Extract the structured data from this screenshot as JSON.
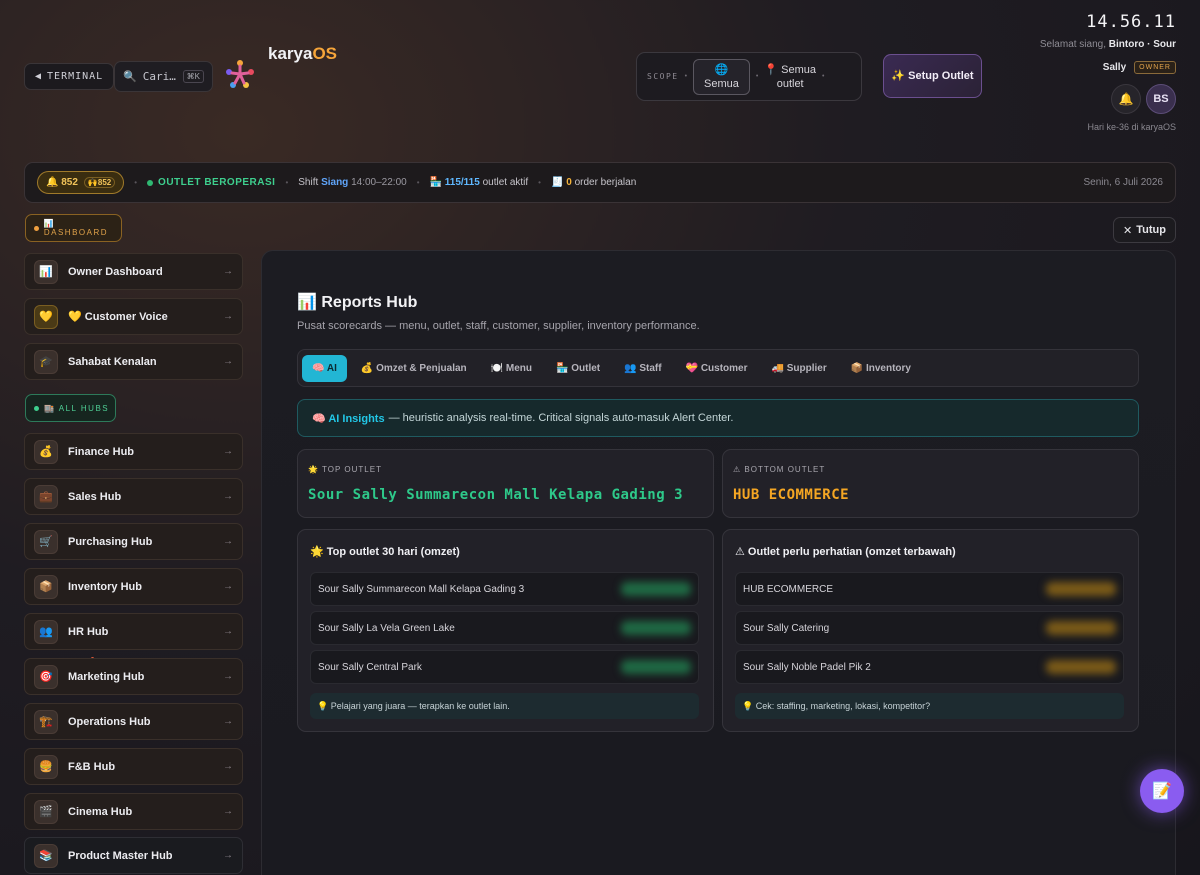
{
  "header": {
    "terminal_label": "TERMINAL",
    "search_placeholder": "Cari…",
    "search_shortcut": "⌘K",
    "brand_main": "karya",
    "brand_accent": "OS",
    "scope_label": "SCOPE",
    "scope_options": [
      "Semua",
      "Semua outlet"
    ],
    "setup_button": "✨ Setup Outlet",
    "clock": "14.56.11",
    "greeting_prefix": "Selamat siang,",
    "greeting_name": "Bintoro · Sour",
    "user_name": "Sally",
    "role_badge": "OWNER",
    "avatar_initials": "BS",
    "day_info": "Hari ke-36 di karyaOS"
  },
  "statusbar": {
    "counter_main": "🔔 852",
    "counter_inner": "🙌852",
    "status_text": "OUTLET BEROPERASI",
    "shift_label": "Shift",
    "shift_name": "Siang",
    "shift_time": "14:00–22:00",
    "outlet_icon": "🏪",
    "outlet_count": "115/115",
    "outlet_text": "outlet aktif",
    "order_icon": "🧾",
    "order_count": "0",
    "order_text": "order berjalan",
    "date": "Senin, 6 Juli 2026"
  },
  "sidebar": {
    "dashboard_badge": "📊 DASHBOARD",
    "hubs_badge": "🏬 ALL HUBS",
    "top_items": [
      {
        "icon": "📊",
        "label": "Owner Dashboard"
      },
      {
        "icon": "💛",
        "label": "💛 Customer Voice"
      },
      {
        "icon": "🎓",
        "label": "Sahabat Kenalan"
      }
    ],
    "hub_items": [
      {
        "icon": "💰",
        "label": "Finance Hub"
      },
      {
        "icon": "💼",
        "label": "Sales Hub"
      },
      {
        "icon": "🛒",
        "label": "Purchasing Hub"
      },
      {
        "icon": "📦",
        "label": "Inventory Hub"
      },
      {
        "icon": "👥",
        "label": "HR Hub"
      },
      {
        "icon": "🎯",
        "label": "Marketing Hub"
      },
      {
        "icon": "🏗️",
        "label": "Operations Hub"
      },
      {
        "icon": "🍔",
        "label": "F&B Hub"
      },
      {
        "icon": "🎬",
        "label": "Cinema Hub"
      },
      {
        "icon": "📚",
        "label": "Product Master Hub"
      }
    ],
    "arrow": "→"
  },
  "main": {
    "close_label": "Tutup",
    "title": "📊 Reports Hub",
    "subtitle": "Pusat scorecards — menu, outlet, staff, customer, supplier, inventory performance.",
    "tabs": [
      "🧠 AI",
      "💰 Omzet & Penjualan",
      "🍽️ Menu",
      "🏪 Outlet",
      "👥 Staff",
      "💝 Customer",
      "🚚 Supplier",
      "📦 Inventory"
    ],
    "insight_ai": "🧠 AI Insights",
    "insight_text": "— heuristic analysis real-time. Critical signals auto-masuk Alert Center.",
    "top_outlet_label": "🌟 TOP OUTLET",
    "top_outlet_value": "Sour Sally Summarecon Mall Kelapa Gading 3",
    "bottom_outlet_label": "⚠ BOTTOM OUTLET",
    "bottom_outlet_value": "HUB ECOMMERCE",
    "top_list_title": "🌟 Top outlet 30 hari (omzet)",
    "top_list": [
      "Sour Sally Summarecon Mall Kelapa Gading 3",
      "Sour Sally La Vela Green Lake",
      "Sour Sally Central Park"
    ],
    "top_tip": "💡 Pelajari yang juara — terapkan ke outlet lain.",
    "bottom_list_title": "⚠ Outlet perlu perhatian (omzet terbawah)",
    "bottom_list": [
      "HUB ECOMMERCE",
      "Sour Sally Catering",
      "Sour Sally Noble Padel Pik 2"
    ],
    "bottom_tip": "💡 Cek: staffing, marketing, lokasi, kompetitor?"
  },
  "fab_icon": "📝"
}
